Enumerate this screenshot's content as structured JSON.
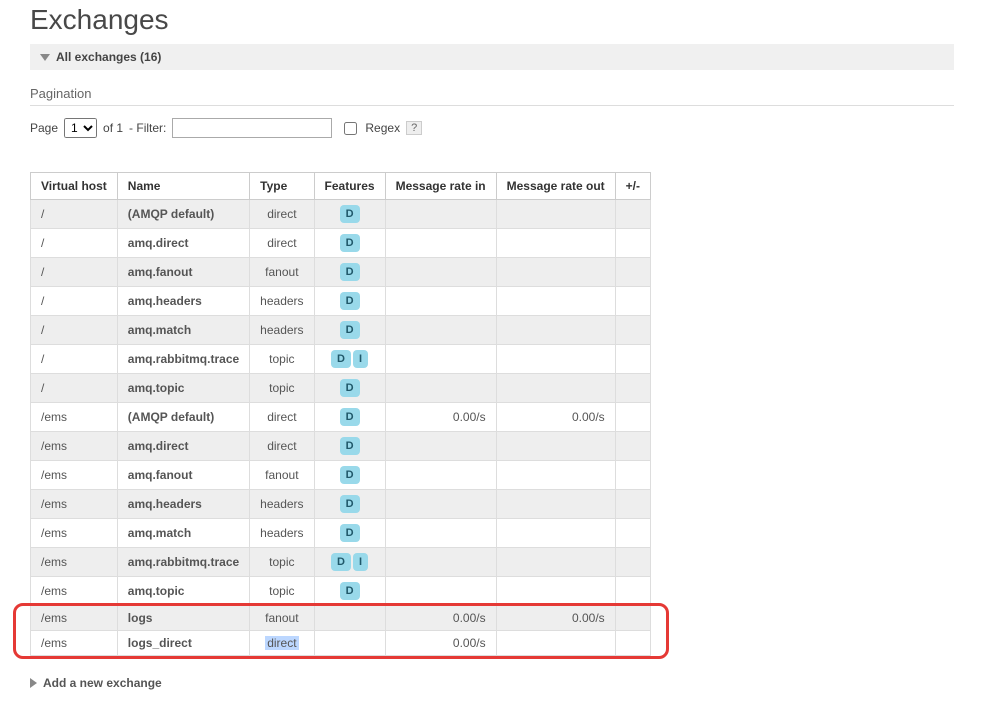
{
  "page_title": "Exchanges",
  "sections": {
    "all_label": "All exchanges (16)",
    "add_label": "Add a new exchange"
  },
  "pagination": {
    "heading": "Pagination",
    "page_label": "Page",
    "page_value": "1",
    "of_label": "of 1",
    "filter_label": "- Filter:",
    "filter_value": "",
    "regex_label": "Regex",
    "help": "?"
  },
  "columns": {
    "vhost": "Virtual host",
    "name": "Name",
    "type": "Type",
    "features": "Features",
    "rate_in": "Message rate in",
    "rate_out": "Message rate out",
    "pm": "+/-"
  },
  "feature_badges": {
    "D": "D",
    "I": "I"
  },
  "rows": [
    {
      "vhost": "/",
      "name": "(AMQP default)",
      "type": "direct",
      "features": [
        "D"
      ],
      "rate_in": "",
      "rate_out": ""
    },
    {
      "vhost": "/",
      "name": "amq.direct",
      "type": "direct",
      "features": [
        "D"
      ],
      "rate_in": "",
      "rate_out": ""
    },
    {
      "vhost": "/",
      "name": "amq.fanout",
      "type": "fanout",
      "features": [
        "D"
      ],
      "rate_in": "",
      "rate_out": ""
    },
    {
      "vhost": "/",
      "name": "amq.headers",
      "type": "headers",
      "features": [
        "D"
      ],
      "rate_in": "",
      "rate_out": ""
    },
    {
      "vhost": "/",
      "name": "amq.match",
      "type": "headers",
      "features": [
        "D"
      ],
      "rate_in": "",
      "rate_out": ""
    },
    {
      "vhost": "/",
      "name": "amq.rabbitmq.trace",
      "type": "topic",
      "features": [
        "D",
        "I"
      ],
      "rate_in": "",
      "rate_out": ""
    },
    {
      "vhost": "/",
      "name": "amq.topic",
      "type": "topic",
      "features": [
        "D"
      ],
      "rate_in": "",
      "rate_out": ""
    },
    {
      "vhost": "/ems",
      "name": "(AMQP default)",
      "type": "direct",
      "features": [
        "D"
      ],
      "rate_in": "0.00/s",
      "rate_out": "0.00/s"
    },
    {
      "vhost": "/ems",
      "name": "amq.direct",
      "type": "direct",
      "features": [
        "D"
      ],
      "rate_in": "",
      "rate_out": ""
    },
    {
      "vhost": "/ems",
      "name": "amq.fanout",
      "type": "fanout",
      "features": [
        "D"
      ],
      "rate_in": "",
      "rate_out": ""
    },
    {
      "vhost": "/ems",
      "name": "amq.headers",
      "type": "headers",
      "features": [
        "D"
      ],
      "rate_in": "",
      "rate_out": ""
    },
    {
      "vhost": "/ems",
      "name": "amq.match",
      "type": "headers",
      "features": [
        "D"
      ],
      "rate_in": "",
      "rate_out": ""
    },
    {
      "vhost": "/ems",
      "name": "amq.rabbitmq.trace",
      "type": "topic",
      "features": [
        "D",
        "I"
      ],
      "rate_in": "",
      "rate_out": ""
    },
    {
      "vhost": "/ems",
      "name": "amq.topic",
      "type": "topic",
      "features": [
        "D"
      ],
      "rate_in": "",
      "rate_out": ""
    },
    {
      "vhost": "/ems",
      "name": "logs",
      "type": "fanout",
      "features": [],
      "rate_in": "0.00/s",
      "rate_out": "0.00/s"
    },
    {
      "vhost": "/ems",
      "name": "logs_direct",
      "type": "direct",
      "features": [],
      "rate_in": "0.00/s",
      "rate_out": "",
      "type_selected": true
    }
  ]
}
